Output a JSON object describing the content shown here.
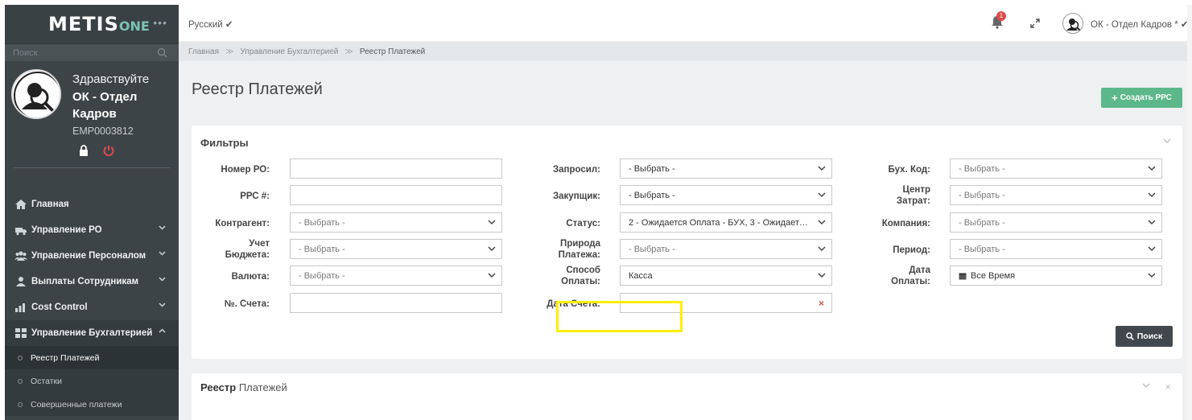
{
  "brand": {
    "name_main": "METIS",
    "name_suffix": "ONE"
  },
  "sidebar": {
    "search_placeholder": "Поиск",
    "greeting": "Здравствуйте",
    "user_name": "ОК - Отдел Кадров",
    "employee_id": "EMP0003812",
    "nav": [
      {
        "label": "Главная",
        "icon": "home-icon"
      },
      {
        "label": "Управление РО",
        "icon": "truck-icon"
      },
      {
        "label": "Управление Персоналом",
        "icon": "users-icon"
      },
      {
        "label": "Выплаты Сотрудникам",
        "icon": "user-icon"
      },
      {
        "label": "Cost Control",
        "icon": "bar-chart-icon"
      },
      {
        "label": "Управление Бухгалтерией",
        "icon": "grid-icon"
      }
    ],
    "subnav": [
      {
        "label": "Реестр Платежей",
        "active": true
      },
      {
        "label": "Остатки",
        "active": false
      },
      {
        "label": "Совершенные платежи",
        "active": false
      }
    ]
  },
  "topbar": {
    "language": "Русский",
    "notifications_count": "1",
    "user_label": "ОК - Отдел Кадров *"
  },
  "breadcrumb": {
    "home": "Главная",
    "section": "Управление Бухгалтерией",
    "current": "Реестр Платежей"
  },
  "page": {
    "title": "Реестр Платежей",
    "create_button": "Создать РРС"
  },
  "filters": {
    "title": "Фильтры",
    "po_number": {
      "label": "Номер РО:",
      "value": ""
    },
    "pps_number": {
      "label": "РРС #:",
      "value": ""
    },
    "counterparty": {
      "label": "Контрагент:",
      "value": "- Выбрать -"
    },
    "budget_line1": "Учет",
    "budget_line2": "Бюджета:",
    "budget_value": "- Выбрать -",
    "currency": {
      "label": "Валюта:",
      "value": "- Выбрать -"
    },
    "invoice_number": {
      "label": "№. Счета:",
      "value": ""
    },
    "requested": {
      "label": "Запросил:",
      "value": "- Выбрать -"
    },
    "buyer": {
      "label": "Закупщик:",
      "value": "- Выбрать -"
    },
    "status": {
      "label": "Статус:",
      "value": "2 - Ожидается Оплата - БУХ, 3 - Ожидается ..."
    },
    "nature_line1": "Природа",
    "nature_line2": "Платежа:",
    "nature_value": "- Выбрать -",
    "method_line1": "Способ",
    "method_line2": "Оплаты:",
    "method_value": "Касса",
    "invoice_date": {
      "label": "Дата Счета:",
      "value": ""
    },
    "acc_code": {
      "label": "Бух. Код:",
      "value": "- Выбрать -"
    },
    "cost_center_line1": "Центр",
    "cost_center_line2": "Затрат:",
    "cost_center_value": "- Выбрать -",
    "company": {
      "label": "Компания:",
      "value": "- Выбрать -"
    },
    "period": {
      "label": "Период:",
      "value": "- Выбрать -"
    },
    "pay_date_line1": "Дата",
    "pay_date_line2": "Оплаты:",
    "pay_date_value": "Все Время",
    "search_button": "Поиск"
  },
  "registry": {
    "title_bold": "Реестр",
    "title_rest": "Платежей"
  },
  "colors": {
    "sidebar": "#3d4448",
    "accent_green": "#5cb88a",
    "highlight": "#ffee00",
    "badge": "#e04b4b"
  }
}
